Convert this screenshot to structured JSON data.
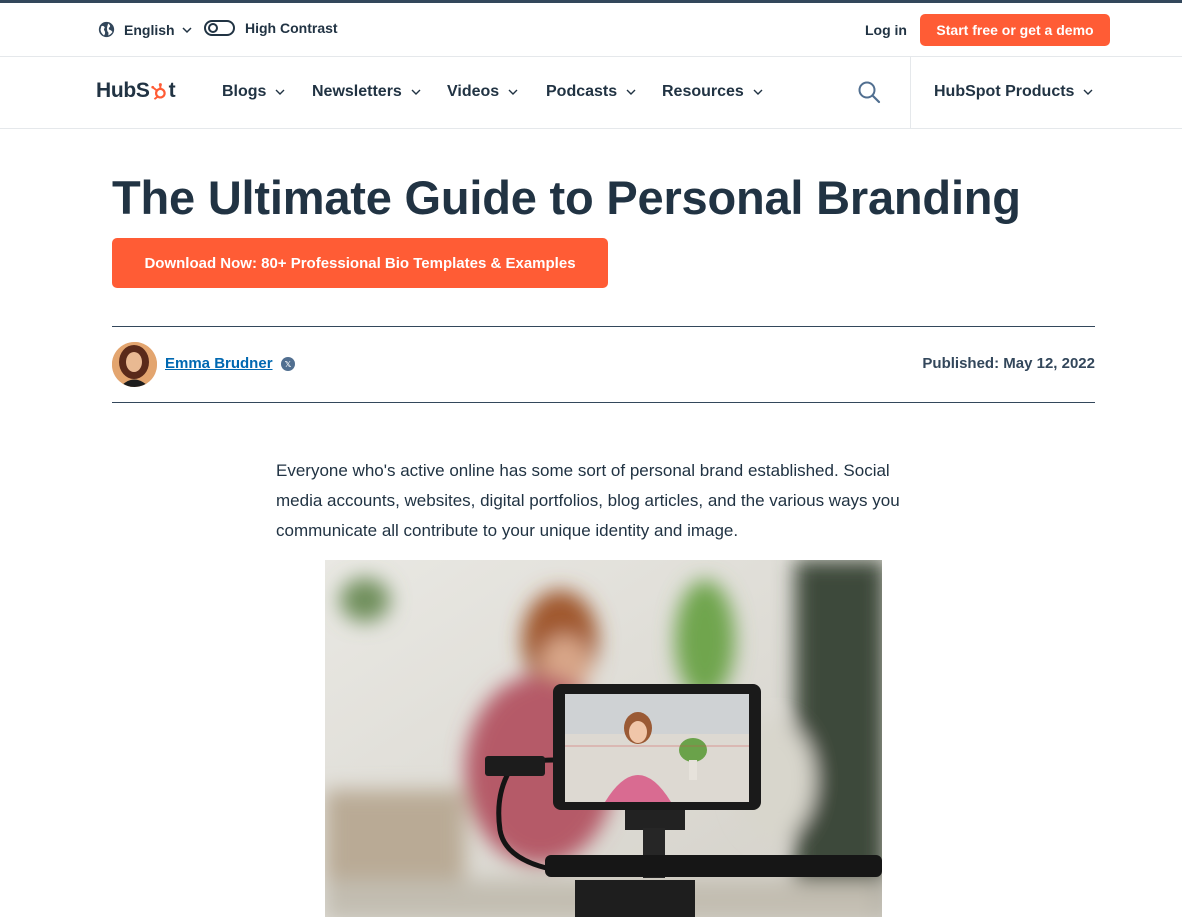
{
  "utility": {
    "language": "English",
    "high_contrast": "High Contrast",
    "login": "Log in",
    "start_cta": "Start free or get a demo"
  },
  "nav": {
    "logo_text_left": "HubS",
    "logo_text_right": "t",
    "items": [
      {
        "label": "Blogs"
      },
      {
        "label": "Newsletters"
      },
      {
        "label": "Videos"
      },
      {
        "label": "Podcasts"
      },
      {
        "label": "Resources"
      }
    ],
    "products": "HubSpot Products"
  },
  "article": {
    "title": "The Ultimate Guide to Personal Branding",
    "cta": "Download Now: 80+ Professional Bio Templates & Examples",
    "author": "Emma Brudner",
    "published": "Published: May 12, 2022",
    "intro": "Everyone who's active online has some sort of personal brand established. Social media accounts, websites, digital portfolios, blog articles, and the various ways you communicate all contribute to your unique identity and image."
  },
  "colors": {
    "brand_orange": "#ff5c35",
    "text_dark": "#213343",
    "link_blue": "#0068b1"
  }
}
